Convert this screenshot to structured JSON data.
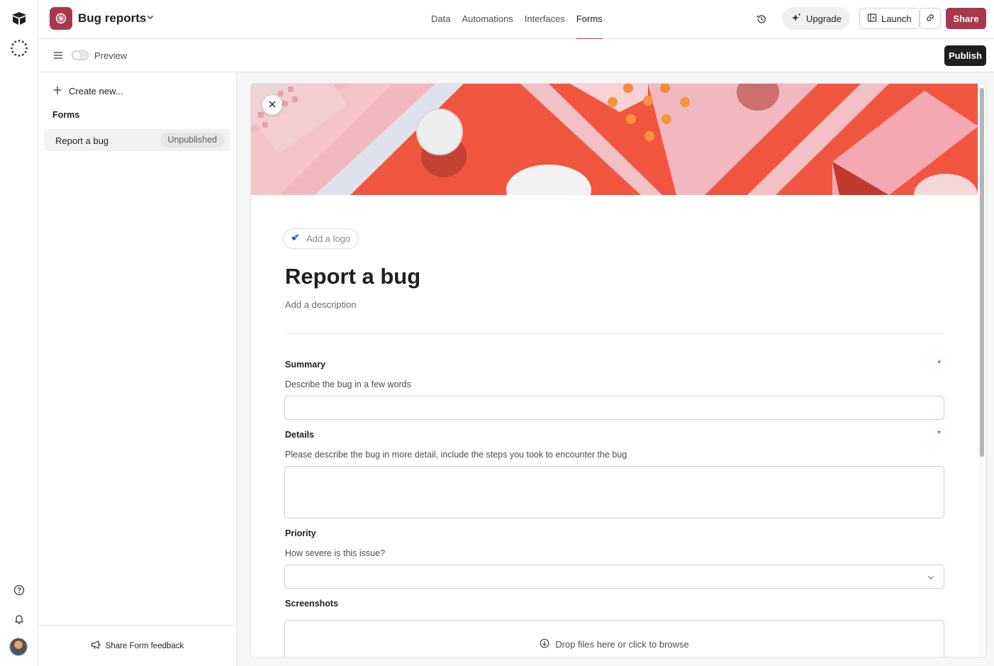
{
  "app": {
    "base_name": "Bug reports"
  },
  "nav": {
    "tabs": [
      {
        "label": "Data"
      },
      {
        "label": "Automations"
      },
      {
        "label": "Interfaces"
      },
      {
        "label": "Forms",
        "active": true
      }
    ]
  },
  "toolbar": {
    "upgrade_label": "Upgrade",
    "launch_label": "Launch",
    "share_label": "Share",
    "publish_label": "Publish",
    "preview_label": "Preview",
    "preview_on": false
  },
  "sidebar": {
    "create_new_label": "Create new...",
    "section_heading": "Forms",
    "items": [
      {
        "label": "Report a bug",
        "badge": "Unpublished"
      }
    ],
    "footer_label": "Share Form feedback"
  },
  "form": {
    "add_logo_label": "Add a logo",
    "title": "Report a bug",
    "description_placeholder": "Add a description",
    "fields": [
      {
        "label": "Summary",
        "help": "Describe the bug in a few words",
        "required": "*",
        "type": "text",
        "value": ""
      },
      {
        "label": "Details",
        "help": "Please describe the bug in more detail, include the steps you took to encounter the bug",
        "required": "*",
        "type": "long-text",
        "value": ""
      },
      {
        "label": "Priority",
        "help": "How severe is this issue?",
        "type": "select",
        "value": ""
      },
      {
        "label": "Screenshots",
        "type": "attachment",
        "drop_label": "Drop files here or click to browse"
      }
    ]
  },
  "colors": {
    "brand": "#a8384a",
    "cover_orange": "#f0563f",
    "cover_pink": "#f2b8bf",
    "required": "#c0394f"
  },
  "icons": {
    "rail": [
      "airtable-logo-icon",
      "workspace-loader-icon",
      "help-icon",
      "bell-icon"
    ],
    "topbar": [
      "base-icon",
      "chevron-down-icon",
      "history-icon",
      "sparkle-icon",
      "launch-icon",
      "link-icon"
    ]
  }
}
